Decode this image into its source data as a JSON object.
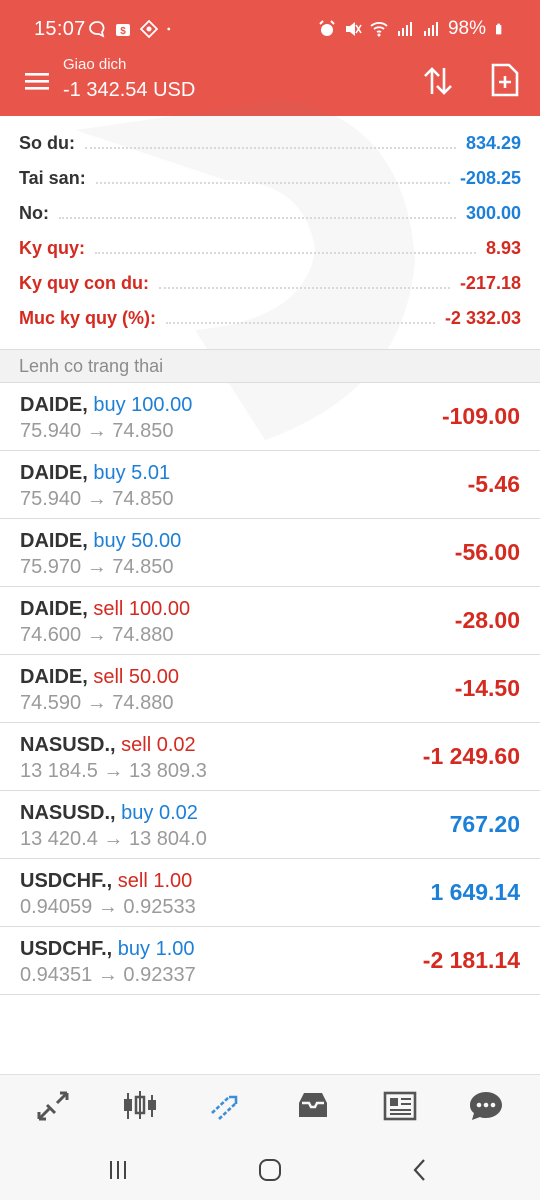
{
  "status_bar": {
    "time": "15:07",
    "battery": "98%"
  },
  "header": {
    "subtitle": "Giao dich",
    "title": "-1 342.54 USD",
    "accent_color": "#e8554b"
  },
  "summary": [
    {
      "label": "So du:",
      "value": "834.29",
      "color": "blue"
    },
    {
      "label": "Tai san:",
      "value": "-208.25",
      "color": "blue"
    },
    {
      "label": "No:",
      "value": "300.00",
      "color": "blue"
    },
    {
      "label": "Ky quy:",
      "value": "8.93",
      "color": "red"
    },
    {
      "label": "Ky quy con du:",
      "value": "-217.18",
      "color": "red"
    },
    {
      "label": "Muc ky quy (%):",
      "value": "-2 332.03",
      "color": "red"
    }
  ],
  "section_title": "Lenh co trang thai",
  "positions": [
    {
      "symbol": "DAIDE,",
      "side": "buy",
      "side_text": "buy 100.00",
      "prices": "75.940 → 74.850",
      "profit": "-109.00",
      "profit_sign": "neg"
    },
    {
      "symbol": "DAIDE,",
      "side": "buy",
      "side_text": "buy 5.01",
      "prices": "75.940 → 74.850",
      "profit": "-5.46",
      "profit_sign": "neg"
    },
    {
      "symbol": "DAIDE,",
      "side": "buy",
      "side_text": "buy 50.00",
      "prices": "75.970 → 74.850",
      "profit": "-56.00",
      "profit_sign": "neg"
    },
    {
      "symbol": "DAIDE,",
      "side": "sell",
      "side_text": "sell 100.00",
      "prices": "74.600 → 74.880",
      "profit": "-28.00",
      "profit_sign": "neg"
    },
    {
      "symbol": "DAIDE,",
      "side": "sell",
      "side_text": "sell 50.00",
      "prices": "74.590 → 74.880",
      "profit": "-14.50",
      "profit_sign": "neg"
    },
    {
      "symbol": "NASUSD.,",
      "side": "sell",
      "side_text": "sell 0.02",
      "prices": "13 184.5 → 13 809.3",
      "profit": "-1 249.60",
      "profit_sign": "neg"
    },
    {
      "symbol": "NASUSD.,",
      "side": "buy",
      "side_text": "buy 0.02",
      "prices": "13 420.4 → 13 804.0",
      "profit": "767.20",
      "profit_sign": "pos"
    },
    {
      "symbol": "USDCHF.,",
      "side": "sell",
      "side_text": "sell 1.00",
      "prices": "0.94059 → 0.92533",
      "profit": "1 649.14",
      "profit_sign": "pos"
    },
    {
      "symbol": "USDCHF.,",
      "side": "buy",
      "side_text": "buy 1.00",
      "prices": "0.94351 → 0.92337",
      "profit": "-2 181.14",
      "profit_sign": "neg"
    }
  ],
  "bottom_nav": [
    {
      "name": "quotes-icon"
    },
    {
      "name": "chart-candles-icon"
    },
    {
      "name": "trade-icon",
      "active": true
    },
    {
      "name": "history-inbox-icon"
    },
    {
      "name": "news-icon"
    },
    {
      "name": "chat-icon"
    }
  ],
  "colors": {
    "blue": "#1c7fd8",
    "red": "#d42a20"
  }
}
